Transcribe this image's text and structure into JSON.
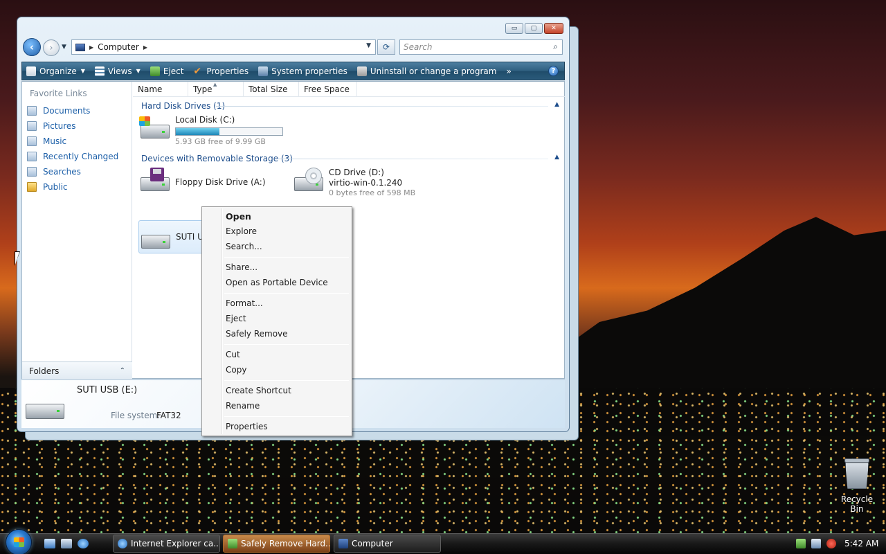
{
  "window": {
    "address": {
      "crumb": "Computer"
    },
    "search_placeholder": "Search",
    "caption": {
      "minimize": "▭",
      "maximize": "▢",
      "close": "✕"
    }
  },
  "toolbar": {
    "items": [
      {
        "label": "Organize",
        "icon": "organize-icon",
        "caret": true
      },
      {
        "label": "Views",
        "icon": "views-icon",
        "caret": true
      },
      {
        "label": "Eject",
        "icon": "eject-icon"
      },
      {
        "label": "Properties",
        "icon": "properties-checkmark-icon"
      },
      {
        "label": "System properties",
        "icon": "system-properties-icon"
      },
      {
        "label": "Uninstall or change a program",
        "icon": "uninstall-icon"
      }
    ],
    "overflow": "»",
    "help": "?"
  },
  "navpane": {
    "title": "Favorite Links",
    "items": [
      {
        "label": "Documents"
      },
      {
        "label": "Pictures"
      },
      {
        "label": "Music"
      },
      {
        "label": "Recently Changed"
      },
      {
        "label": "Searches"
      },
      {
        "label": "Public"
      }
    ],
    "folders_label": "Folders"
  },
  "columns": [
    "Name",
    "Type",
    "Total Size",
    "Free Space"
  ],
  "groups": {
    "hard_disks": {
      "title": "Hard Disk Drives (1)",
      "drives": [
        {
          "name": "Local Disk (C:)",
          "free_text": "5.93 GB free of 9.99 GB",
          "used_fraction": 0.41
        }
      ]
    },
    "removable": {
      "title": "Devices with Removable Storage (3)",
      "drives": [
        {
          "name": "Floppy Disk Drive (A:)"
        },
        {
          "name": "CD Drive (D:)",
          "label": "virtio-win-0.1.240",
          "free_text": "0 bytes free of 598 MB"
        },
        {
          "name": "SUTI USB (E:)",
          "visible_name": "SUTI US"
        }
      ]
    }
  },
  "details": {
    "name": "SUTI USB (E:)",
    "fs_label": "File system:",
    "fs_value": "FAT32"
  },
  "context_menu": {
    "items": [
      {
        "label": "Open",
        "bold": true
      },
      {
        "label": "Explore"
      },
      {
        "label": "Search..."
      },
      {
        "label": "Share..."
      },
      {
        "label": "Open as Portable Device"
      },
      {
        "label": "Format..."
      },
      {
        "label": "Eject"
      },
      {
        "label": "Safely Remove"
      },
      {
        "label": "Cut"
      },
      {
        "label": "Copy"
      },
      {
        "label": "Create Shortcut"
      },
      {
        "label": "Rename"
      },
      {
        "label": "Properties"
      }
    ]
  },
  "desktop": {
    "recycle_bin": "Recycle Bin"
  },
  "taskbar": {
    "tasks": [
      {
        "label": "Internet Explorer ca..."
      },
      {
        "label": "Safely Remove Hard..."
      },
      {
        "label": "Computer"
      }
    ],
    "clock": "5:42 AM"
  }
}
